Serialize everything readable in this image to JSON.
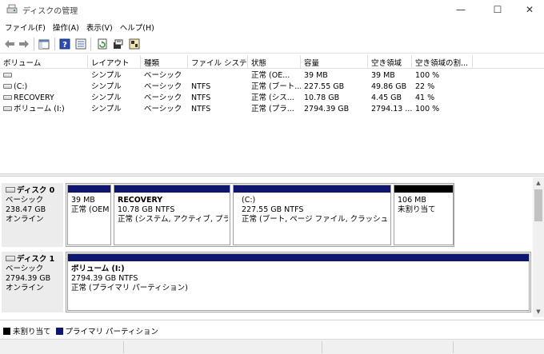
{
  "window": {
    "title": "ディスクの管理",
    "minimize": "—",
    "maximize": "☐",
    "close": "✕"
  },
  "menu": [
    "ファイル(F)",
    "操作(A)",
    "表示(V)",
    "ヘルプ(H)"
  ],
  "toolbar": {
    "icons": [
      "back-arrow-icon",
      "forward-arrow-icon",
      "properties-pane-icon",
      "help-icon",
      "list-view-icon",
      "refresh-icon",
      "settings-icon",
      "disk-properties-icon"
    ]
  },
  "volume_list": {
    "columns": [
      "ボリューム",
      "レイアウト",
      "種類",
      "ファイル システム",
      "状態",
      "容量",
      "空き領域",
      "空き領域の割..."
    ],
    "rows": [
      [
        "",
        "シンプル",
        "ベーシック",
        "",
        "正常 (OE...",
        "39 MB",
        "39 MB",
        "100 %"
      ],
      [
        "(C:)",
        "シンプル",
        "ベーシック",
        "NTFS",
        "正常 (ブート...",
        "227.55 GB",
        "49.86 GB",
        "22 %"
      ],
      [
        "RECOVERY",
        "シンプル",
        "ベーシック",
        "NTFS",
        "正常 (シス...",
        "10.78 GB",
        "4.45 GB",
        "41 %"
      ],
      [
        "ボリューム (I:)",
        "シンプル",
        "ベーシック",
        "NTFS",
        "正常 (プラ...",
        "2794.39 GB",
        "2794.13 ...",
        "100 %"
      ]
    ]
  },
  "disks": [
    {
      "name": "ディスク 0",
      "type": "ベーシック",
      "size": "238.47 GB",
      "status": "オンライン",
      "partitions": [
        {
          "name": "",
          "size": "39 MB",
          "status": "正常 (OEM",
          "bar": "primary"
        },
        {
          "name": "RECOVERY",
          "size": "10.78 GB NTFS",
          "status": "正常 (システム, アクティブ, プライマ",
          "bar": "primary"
        },
        {
          "name": "(C:)",
          "size": "227.55 GB NTFS",
          "status": "正常 (ブート, ページ ファイル, クラッシュ ダンプ, ",
          "bar": "primary"
        },
        {
          "name": "",
          "size": "106 MB",
          "status": "未割り当て",
          "bar": "unallocated"
        }
      ]
    },
    {
      "name": "ディスク 1",
      "type": "ベーシック",
      "size": "2794.39 GB",
      "status": "オンライン",
      "partitions": [
        {
          "name": "ボリューム (I:)",
          "size": "2794.39 GB NTFS",
          "status": "正常 (プライマリ パーティション)",
          "bar": "primary"
        }
      ]
    }
  ],
  "legend": [
    {
      "label": "未割り当て",
      "color": "#000000"
    },
    {
      "label": "プライマリ パーティション",
      "color": "#0e1670"
    }
  ],
  "scrollbar": {
    "up": "▲",
    "down": "▼"
  }
}
